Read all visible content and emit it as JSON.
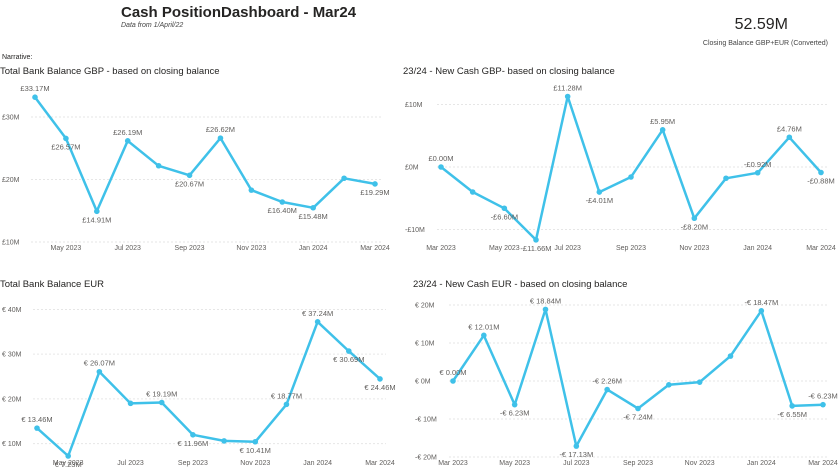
{
  "header": {
    "title": "Cash PositionDashboard - Mar24",
    "subtitle": "Data from 1/April/22",
    "kpi_value": "52.59M",
    "kpi_label": "Closing Balance GBP+EUR (Converted)",
    "narrative": "Narrative:"
  },
  "colors": {
    "line": "#3FC1E9",
    "grid": "#E6E6E6",
    "text": "#605E5C"
  },
  "chart_data": [
    {
      "id": "gbp-balance",
      "type": "line",
      "title": "Total Bank Balance GBP - based on closing balance",
      "x": [
        "Apr 2023",
        "May 2023",
        "Jun 2023",
        "Jul 2023",
        "Aug 2023",
        "Sep 2023",
        "Oct 2023",
        "Nov 2023",
        "Dec 2023",
        "Jan 2024",
        "Feb 2024",
        "Mar 2024"
      ],
      "x_tick_labels": [
        "May 2023",
        "Jul 2023",
        "Sep 2023",
        "Nov 2023",
        "Jan 2024",
        "Mar 2024"
      ],
      "values": [
        33.17,
        26.57,
        14.91,
        26.19,
        22.2,
        20.67,
        26.62,
        18.3,
        16.4,
        15.48,
        20.2,
        19.29
      ],
      "data_labels": [
        "£33.17M",
        "£26.57M",
        "£14.91M",
        "£26.19M",
        "",
        "£20.67M",
        "£26.62M",
        "",
        "£16.40M",
        "£15.48M",
        "",
        "£19.29M"
      ],
      "y_ticks": [
        10,
        20,
        30
      ],
      "y_tick_labels": [
        "£10M",
        "£20M",
        "£30M"
      ],
      "ylim": [
        10,
        34
      ],
      "grid": true
    },
    {
      "id": "gbp-newcash",
      "type": "line",
      "title": "23/24 - New Cash GBP- based on closing balance",
      "x": [
        "Apr 2023",
        "May 2023",
        "Jun 2023",
        "Jul 2023",
        "Aug 2023",
        "Sep 2023",
        "Oct 2023",
        "Nov 2023",
        "Dec 2023",
        "Jan 2024",
        "Feb 2024",
        "Mar 2024"
      ],
      "x_tick_labels": [
        "Mar 2023",
        "May 2023",
        "Jul 2023",
        "Sep 2023",
        "Nov 2023",
        "Jan 2024",
        "Mar 2024"
      ],
      "values": [
        0.0,
        -4.0,
        -6.6,
        -11.66,
        11.28,
        -4.01,
        -1.6,
        5.95,
        -8.2,
        -1.8,
        -0.92,
        4.76,
        -0.88
      ],
      "data_labels": [
        "£0.00M",
        "",
        "-£6.60M",
        "-£11.66M",
        "£11.28M",
        "-£4.01M",
        "",
        "£5.95M",
        "-£8.20M",
        "",
        "-£0.92M",
        "£4.76M",
        "-£0.88M"
      ],
      "y_ticks": [
        -10,
        0,
        10
      ],
      "y_tick_labels": [
        "-£10M",
        "£0M",
        "£10M"
      ],
      "ylim": [
        -12,
        12
      ],
      "grid": true
    },
    {
      "id": "eur-balance",
      "type": "line",
      "title": "Total Bank Balance EUR",
      "x": [
        "Apr 2023",
        "May 2023",
        "Jun 2023",
        "Jul 2023",
        "Aug 2023",
        "Sep 2023",
        "Oct 2023",
        "Nov 2023",
        "Dec 2023",
        "Jan 2024",
        "Feb 2024",
        "Mar 2024"
      ],
      "x_tick_labels": [
        "May 2023",
        "Jul 2023",
        "Sep 2023",
        "Nov 2023",
        "Jan 2024",
        "Mar 2024"
      ],
      "values": [
        13.46,
        7.23,
        26.07,
        19.0,
        19.19,
        11.96,
        10.6,
        10.41,
        18.77,
        37.24,
        30.69,
        24.46
      ],
      "data_labels": [
        "€ 13.46M",
        "€ 7.23M",
        "€ 26.07M",
        "",
        "€ 19.19M",
        "€ 11.96M",
        "",
        "€ 10.41M",
        "€ 18.77M",
        "€ 37.24M",
        "€ 30.69M",
        "€ 24.46M"
      ],
      "y_ticks": [
        10,
        20,
        30,
        40
      ],
      "y_tick_labels": [
        "€ 10M",
        "€ 20M",
        "€ 30M",
        "€ 40M"
      ],
      "ylim": [
        7,
        41
      ],
      "grid": true
    },
    {
      "id": "eur-newcash",
      "type": "line",
      "title": "23/24 - New Cash EUR - based on closing balance",
      "x": [
        "Mar 2023",
        "Apr 2023",
        "May 2023",
        "Jun 2023",
        "Jul 2023",
        "Aug 2023",
        "Sep 2023",
        "Oct 2023",
        "Nov 2023",
        "Dec 2023",
        "Jan 2024",
        "Feb 2024",
        "Mar 2024"
      ],
      "x_tick_labels": [
        "Mar 2023",
        "May 2023",
        "Jul 2023",
        "Sep 2023",
        "Nov 2023",
        "Jan 2024",
        "Mar 2024"
      ],
      "values": [
        0.0,
        12.01,
        -6.23,
        18.84,
        -17.13,
        -2.26,
        -7.24,
        -1.0,
        -0.3,
        6.55,
        18.47,
        -6.55,
        -6.23
      ],
      "data_labels": [
        "€ 0.00M",
        "€ 12.01M",
        "-€ 6.23M",
        "€ 18.84M",
        "-€ 17.13M",
        "-€ 2.26M",
        "-€ 7.24M",
        "",
        "",
        "",
        "-€ 18.47M",
        "-€ 6.55M",
        "-€ 6.23M"
      ],
      "y_ticks": [
        -20,
        -10,
        0,
        10,
        20
      ],
      "y_tick_labels": [
        "-€ 20M",
        "-€ 10M",
        "€ 0M",
        "€ 10M",
        "€ 20M"
      ],
      "ylim": [
        -20,
        20
      ],
      "grid": true
    }
  ]
}
